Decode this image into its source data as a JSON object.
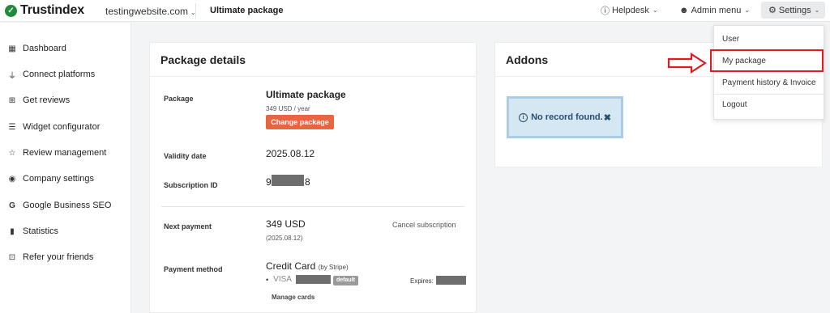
{
  "header": {
    "brand": "Trustindex",
    "site": "testingwebsite.com",
    "page_title": "Ultimate package",
    "helpdesk": "Helpdesk",
    "admin_menu": "Admin menu",
    "settings": "Settings"
  },
  "sidebar": {
    "items": [
      {
        "label": "Dashboard",
        "icon": "grid-icon"
      },
      {
        "label": "Connect platforms",
        "icon": "plug-icon"
      },
      {
        "label": "Get reviews",
        "icon": "message-plus-icon"
      },
      {
        "label": "Widget configurator",
        "icon": "sliders-icon"
      },
      {
        "label": "Review management",
        "icon": "star-icon"
      },
      {
        "label": "Company settings",
        "icon": "globe-icon"
      },
      {
        "label": "Google Business SEO",
        "icon": "google-icon"
      },
      {
        "label": "Statistics",
        "icon": "bar-chart-icon"
      },
      {
        "label": "Refer your friends",
        "icon": "gift-icon"
      }
    ]
  },
  "package": {
    "title": "Package details",
    "package_label": "Package",
    "package_name": "Ultimate package",
    "price": "349 USD / year",
    "change_button": "Change package",
    "validity_label": "Validity date",
    "validity_value": "2025.08.12",
    "subscription_label": "Subscription ID",
    "subscription_prefix": "9",
    "subscription_suffix": "8",
    "next_payment_label": "Next payment",
    "next_payment_value": "349 USD",
    "next_payment_date": "(2025.08.12)",
    "cancel_link": "Cancel subscription",
    "payment_method_label": "Payment method",
    "payment_method_value": "Credit Card",
    "payment_method_provider": "(by Stripe)",
    "card_brand": "VISA",
    "default_badge": "default",
    "expires_label": "Expires:",
    "manage_cards": "Manage cards"
  },
  "addons": {
    "title": "Addons",
    "empty_message": "No record found."
  },
  "settings_menu": {
    "items": [
      "User",
      "My package",
      "Payment history & Invoice",
      "Logout"
    ]
  },
  "colors": {
    "brand_green": "#1e8a3a",
    "accent_orange": "#e8653f",
    "highlight_red": "#e11b22",
    "info_blue": "#d4e7f3"
  }
}
